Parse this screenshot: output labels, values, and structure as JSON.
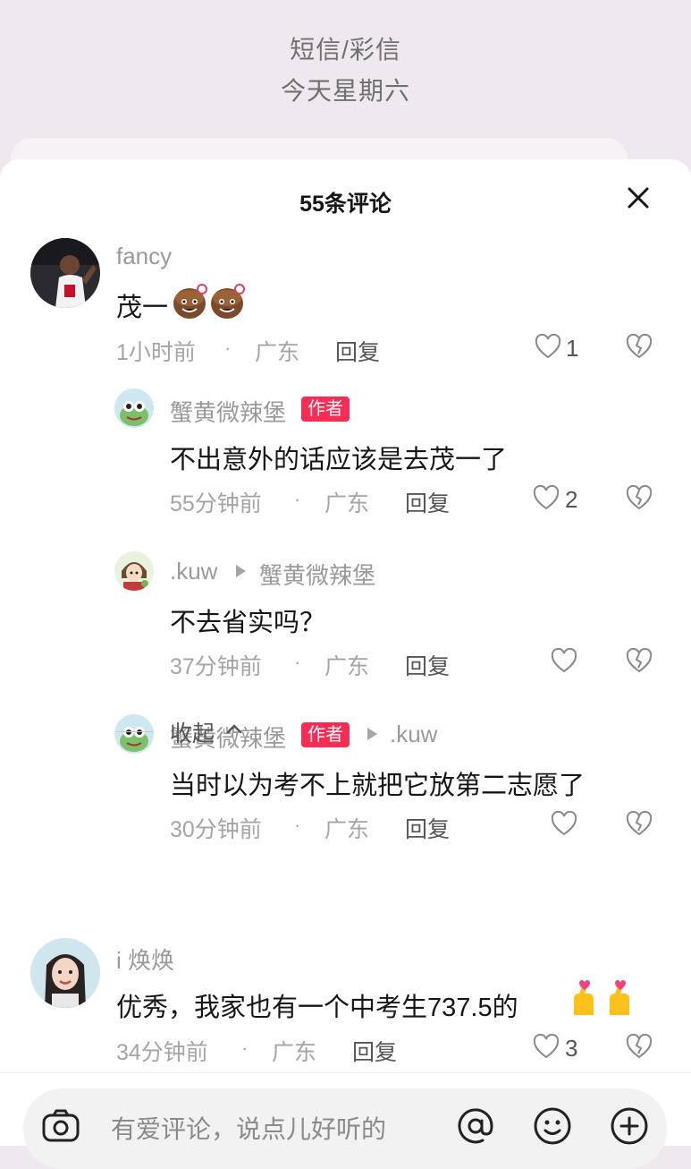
{
  "background": {
    "line1": "短信/彩信",
    "line2": "今天星期六"
  },
  "sheet": {
    "title": "55条评论"
  },
  "comments": [
    {
      "user": "fancy",
      "text": "茂一",
      "emoji": "hamburger-face-emoji x2",
      "time": "1小时前",
      "location": "广东",
      "reply_label": "回复",
      "likes": "1"
    },
    {
      "user": "蟹黄微辣堡",
      "badge": "作者",
      "text": "不出意外的话应该是去茂一了",
      "time": "55分钟前",
      "location": "广东",
      "reply_label": "回复",
      "likes": "2"
    },
    {
      "user": ".kuw",
      "reply_to": "蟹黄微辣堡",
      "text": "不去省实吗？",
      "time": "37分钟前",
      "location": "广东",
      "reply_label": "回复",
      "likes": ""
    },
    {
      "user": "蟹黄微辣堡",
      "badge": "作者",
      "reply_to": ".kuw",
      "text": "当时以为考不上就把它放第二志愿了",
      "time": "30分钟前",
      "location": "广东",
      "reply_label": "回复",
      "likes": ""
    },
    {
      "user": "i  焕焕",
      "text": "优秀，我家也有一个中考生737.5的",
      "emoji": "finger-heart-emoji x2",
      "time": "34分钟前",
      "location": "广东",
      "reply_label": "回复",
      "likes": "3"
    }
  ],
  "collapse": {
    "label": "收起"
  },
  "input": {
    "placeholder": "有爱评论，说点儿好听的"
  },
  "colors": {
    "badge": "#fe2c55",
    "text_primary": "#161616",
    "text_secondary": "#a5a5a5"
  },
  "icons": [
    "close-icon",
    "heart-icon",
    "broken-heart-icon",
    "camera-icon",
    "at-icon",
    "emoji-icon",
    "plus-icon",
    "chevron-up-icon",
    "play-triangle-icon"
  ],
  "separator": "·"
}
